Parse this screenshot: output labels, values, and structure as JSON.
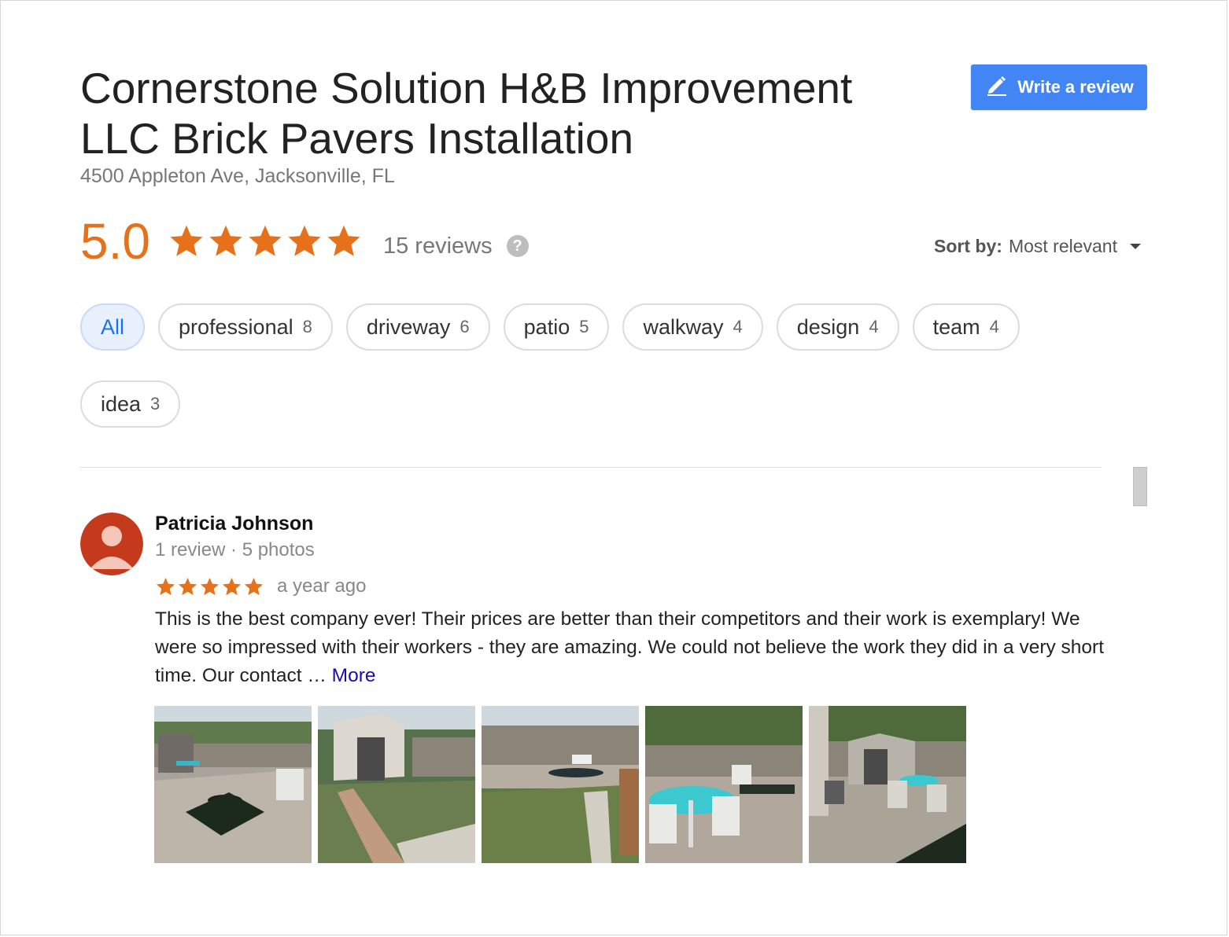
{
  "business": {
    "name": "Cornerstone Solution H&B Improvement LLC Brick Pavers Installation",
    "address": "4500 Appleton Ave, Jacksonville, FL"
  },
  "actions": {
    "write_review_label": "Write a review"
  },
  "rating": {
    "value": "5.0",
    "stars": 5,
    "reviews_label": "15 reviews",
    "help_icon_glyph": "?"
  },
  "sort": {
    "label": "Sort by:",
    "value": "Most relevant"
  },
  "topics": [
    {
      "label": "All",
      "count": ""
    },
    {
      "label": "professional",
      "count": "8"
    },
    {
      "label": "driveway",
      "count": "6"
    },
    {
      "label": "patio",
      "count": "5"
    },
    {
      "label": "walkway",
      "count": "4"
    },
    {
      "label": "design",
      "count": "4"
    },
    {
      "label": "team",
      "count": "4"
    },
    {
      "label": "idea",
      "count": "3"
    }
  ],
  "review": {
    "author": "Patricia Johnson",
    "meta": "1 review · 5 photos",
    "stars": 5,
    "time": "a year ago",
    "text": "This is the best company ever! Their prices are better than their competitors and their work is exemplary! We were so impressed with their workers - they are amazing. We could not believe the work they did in a very short time. Our contact … ",
    "more_label": "More",
    "photo_count": 5
  },
  "colors": {
    "accent_orange": "#e7711b",
    "button_blue": "#4285f4",
    "link_blue": "#1a0dab",
    "chip_active_bg": "#e8f0fe",
    "avatar_red": "#c5391c"
  },
  "icons": {
    "write_button": "pencil-icon",
    "help": "help-circle-icon",
    "sort": "caret-down-icon",
    "rating": "star-icon",
    "avatar": "person-icon"
  }
}
